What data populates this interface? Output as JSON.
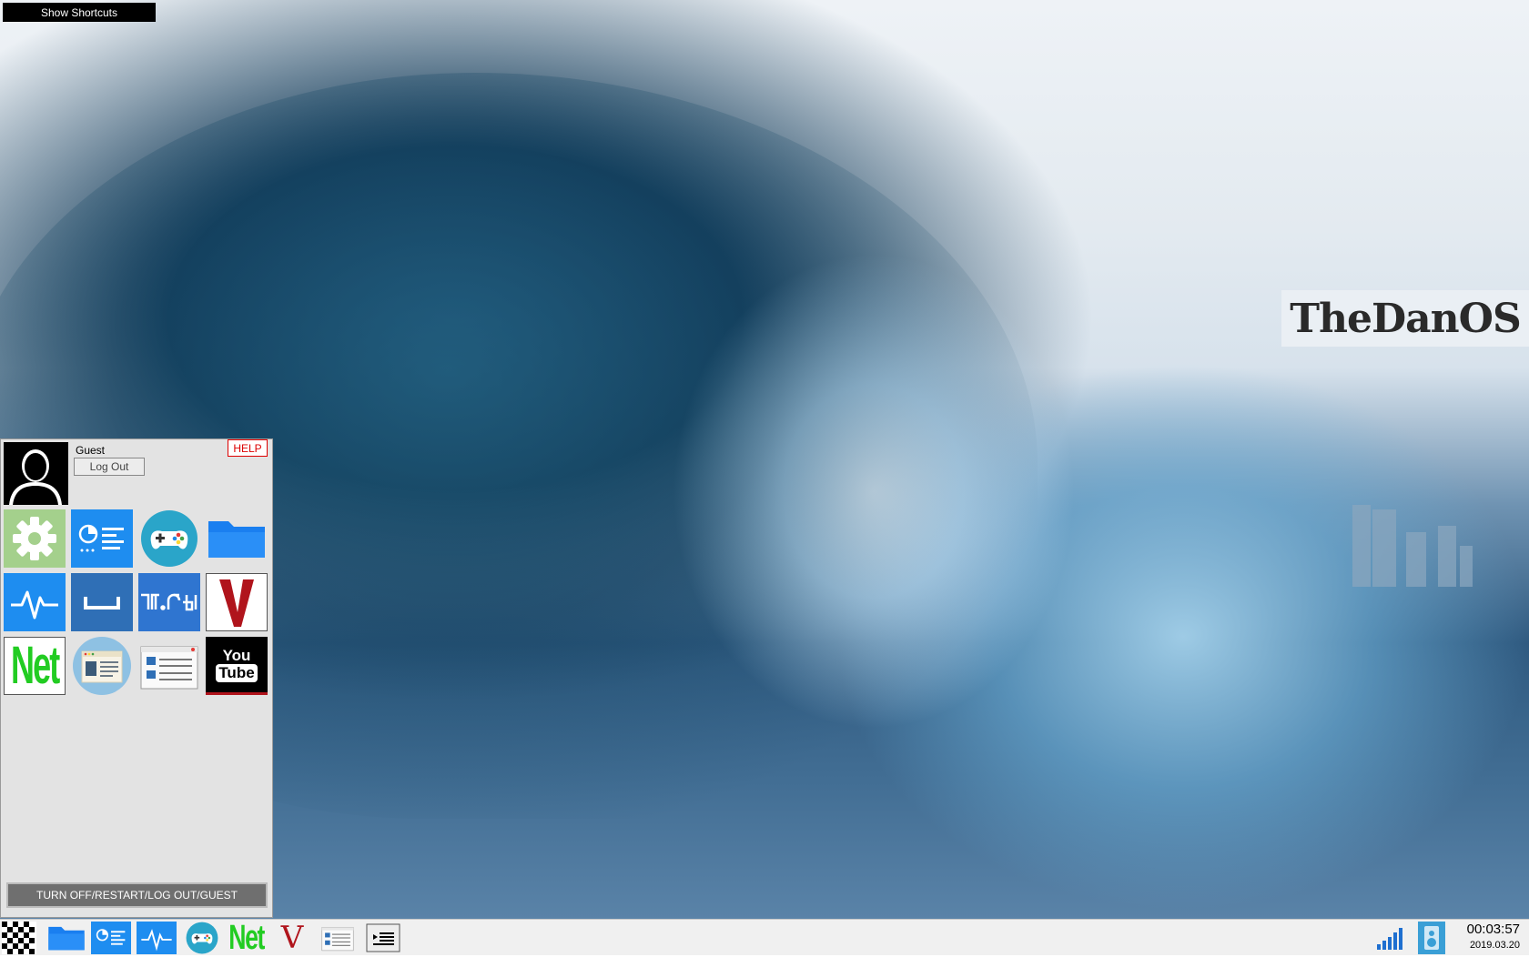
{
  "desktop": {
    "show_shortcuts_label": "Show Shortcuts",
    "logo_text": "TheDanOS"
  },
  "start_menu": {
    "username": "Guest",
    "logout_label": "Log Out",
    "help_label": "HELP",
    "power_label": "TURN OFF/RESTART/LOG OUT/GUEST",
    "apps": [
      {
        "name": "settings-app",
        "icon": "gear-icon"
      },
      {
        "name": "dashboard-app",
        "icon": "dashboard-list-icon"
      },
      {
        "name": "games-app",
        "icon": "gamepad-icon"
      },
      {
        "name": "files-app",
        "icon": "folder-icon"
      },
      {
        "name": "monitor-app",
        "icon": "pulse-icon"
      },
      {
        "name": "space-app",
        "icon": "space-key-icon"
      },
      {
        "name": "notation-app",
        "icon": "glyph-icon"
      },
      {
        "name": "v-app",
        "icon": "v-letter-icon"
      },
      {
        "name": "net-app",
        "icon": "net-text-icon",
        "text": "Net"
      },
      {
        "name": "reader-app",
        "icon": "document-window-icon"
      },
      {
        "name": "lists-app",
        "icon": "list-window-icon"
      },
      {
        "name": "youtube-app",
        "icon": "youtube-icon",
        "text_top": "You",
        "text_bottom": "Tube"
      }
    ]
  },
  "taskbar": {
    "net_label": "Net",
    "v_label": "V",
    "clock_time": "00:03:57",
    "clock_date": "2019.03.20"
  },
  "colors": {
    "tile_blue": "#1e8df0",
    "tile_dark_blue": "#2f6fb6",
    "net_green": "#22cc22",
    "v_red": "#b0141c",
    "help_red": "#dd0000"
  }
}
